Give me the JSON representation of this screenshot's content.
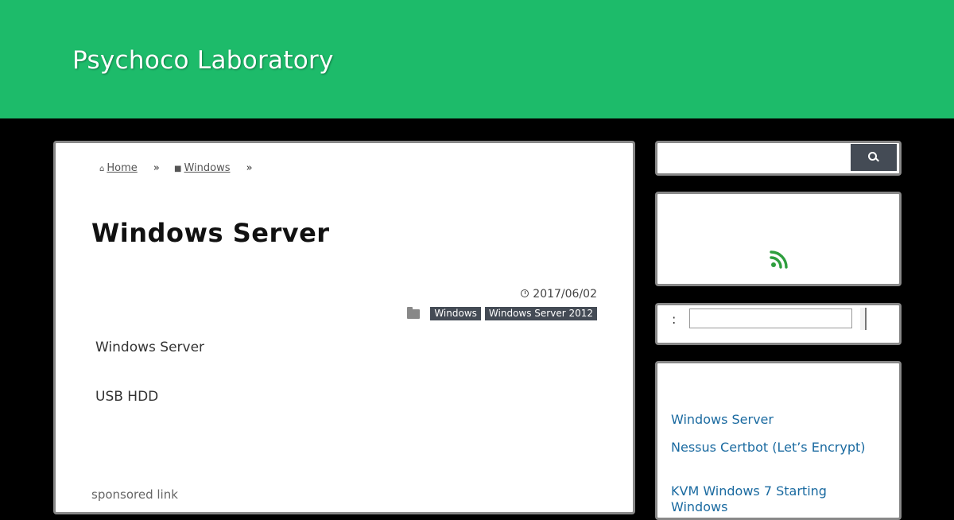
{
  "site": {
    "title": "Psychoco Laboratory"
  },
  "breadcrumb": {
    "home": "Home",
    "category": "Windows",
    "separator": "»"
  },
  "article": {
    "title": "Windows Server",
    "date": "2017/06/02",
    "categories": [
      "Windows",
      "Windows Server 2012"
    ],
    "paragraphs": [
      "Windows Server",
      "USB HDD"
    ],
    "sponsored": "sponsored link"
  },
  "sidebar": {
    "search": {
      "value": ""
    },
    "field": {
      "label": ":",
      "value": ""
    },
    "links": [
      "Windows Server",
      "Nessus  Certbot (Let’s Encrypt)",
      "KVM  Windows 7  Starting",
      "Windows"
    ]
  },
  "colors": {
    "header": "#1dbb6a",
    "background": "#000000",
    "tag": "#444b55",
    "link": "#1a6aa0",
    "rss": "#2e9e3e"
  },
  "icons": [
    "home-icon",
    "folder-icon",
    "clock-icon",
    "search-icon",
    "rss-icon"
  ]
}
